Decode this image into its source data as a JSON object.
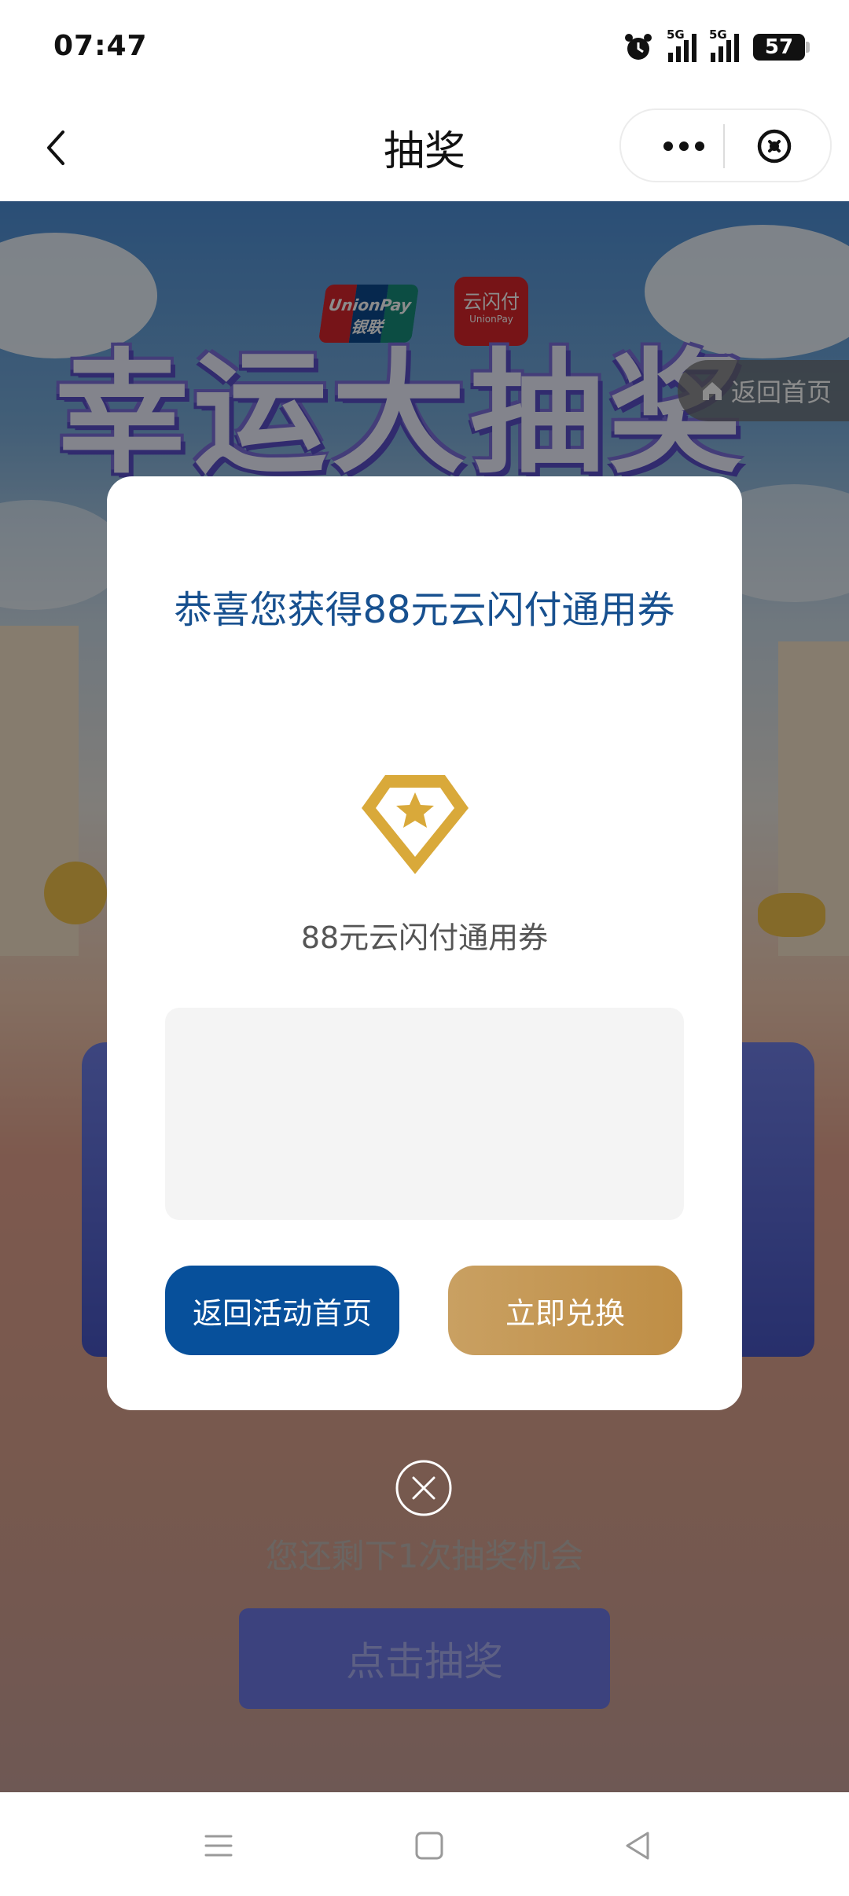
{
  "status_bar": {
    "time": "07:47",
    "network_1": "5G",
    "network_2": "5G",
    "battery": "57"
  },
  "nav": {
    "title": "抽奖",
    "more_icon": "more-dots-icon",
    "close_icon": "close-circle-icon"
  },
  "background": {
    "logo_unionpay": "UnionPay 银联",
    "logo_yunshanfu": "云闪付",
    "logo_yunshanfu_sub": "UnionPay",
    "banner_title": "幸运大抽奖",
    "home_pill": "返回首页",
    "remaining_text": "您还剩下1次抽奖机会",
    "draw_button": "点击抽奖"
  },
  "modal": {
    "title": "恭喜您获得88元云闪付通用券",
    "prize_icon": "diamond-star-icon",
    "prize_name": "88元云闪付通用券",
    "button_home": "返回活动首页",
    "button_redeem": "立即兑换",
    "close_icon": "close-circle-icon"
  },
  "colors": {
    "title_blue": "#17508f",
    "button_blue": "#07509b",
    "button_gold": "#c9a062",
    "icon_gold": "#d9a93a"
  },
  "system_nav": {
    "menu_icon": "menu-icon",
    "home_icon": "home-square-icon",
    "back_icon": "back-triangle-icon"
  }
}
